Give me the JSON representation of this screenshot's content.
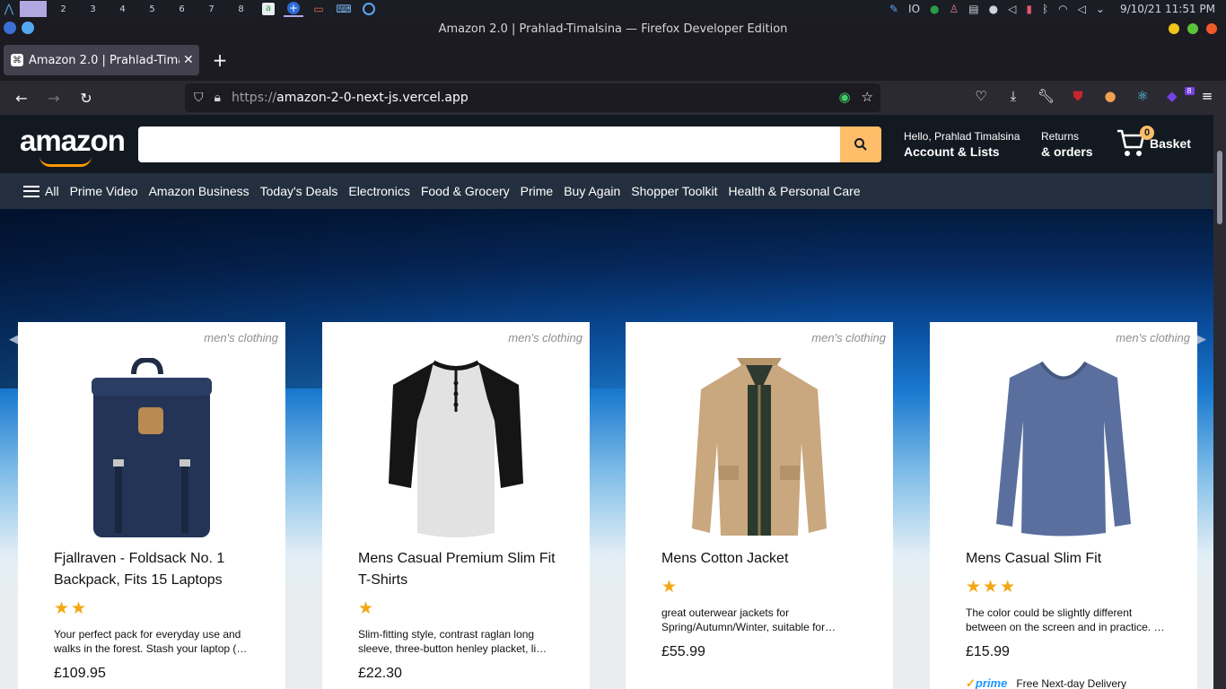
{
  "system": {
    "workspaces": [
      "1",
      "2",
      "3",
      "4",
      "5",
      "6",
      "7",
      "8"
    ],
    "active_workspace": "1",
    "tray": {
      "vpn": "IO",
      "datetime": "9/10/21  11:51 PM"
    }
  },
  "window": {
    "title": "Amazon 2.0 | Prahlad-Timalsina — Firefox Developer Edition"
  },
  "browser": {
    "tab_title": "Amazon 2.0 | Prahlad-Timalsina",
    "url_protocol": "https://",
    "url_host": "amazon-2-0-next-js.vercel.app",
    "extension_badge": "8"
  },
  "amazon": {
    "logo": "amazon",
    "search_placeholder": "",
    "account_greeting": "Hello, Prahlad Timalsina",
    "account_label": "Account & Lists",
    "returns_label": "Returns",
    "orders_label": "& orders",
    "basket_count": "0",
    "basket_label": "Basket",
    "nav_items": [
      "All",
      "Prime Video",
      "Amazon Business",
      "Today's Deals",
      "Electronics",
      "Food & Grocery",
      "Prime",
      "Buy Again",
      "Shopper Toolkit",
      "Health & Personal Care"
    ]
  },
  "products": [
    {
      "category": "men's clothing",
      "title": "Fjallraven - Foldsack No. 1 Backpack, Fits 15 Laptops",
      "rating": 2,
      "stars": "★★",
      "description": "Your perfect pack for everyday use and walks in the forest. Stash your laptop (…",
      "price": "£109.95",
      "image": "backpack"
    },
    {
      "category": "men's clothing",
      "title": "Mens Casual Premium Slim Fit T-Shirts",
      "rating": 1,
      "stars": "★",
      "description": "Slim-fitting style, contrast raglan long sleeve, three-button henley placket, li…",
      "price": "£22.30",
      "image": "tshirt"
    },
    {
      "category": "men's clothing",
      "title": "Mens Cotton Jacket",
      "rating": 1,
      "stars": "★",
      "description": "great outerwear jackets for Spring/Autumn/Winter, suitable for…",
      "price": "£55.99",
      "image": "jacket"
    },
    {
      "category": "men's clothing",
      "title": "Mens Casual Slim Fit",
      "rating": 3,
      "stars": "★★★",
      "description": "The color could be slightly different between on the screen and in practice. …",
      "price": "£15.99",
      "image": "longsleeve",
      "prime_label": "prime",
      "delivery": "Free Next-day Delivery"
    }
  ]
}
